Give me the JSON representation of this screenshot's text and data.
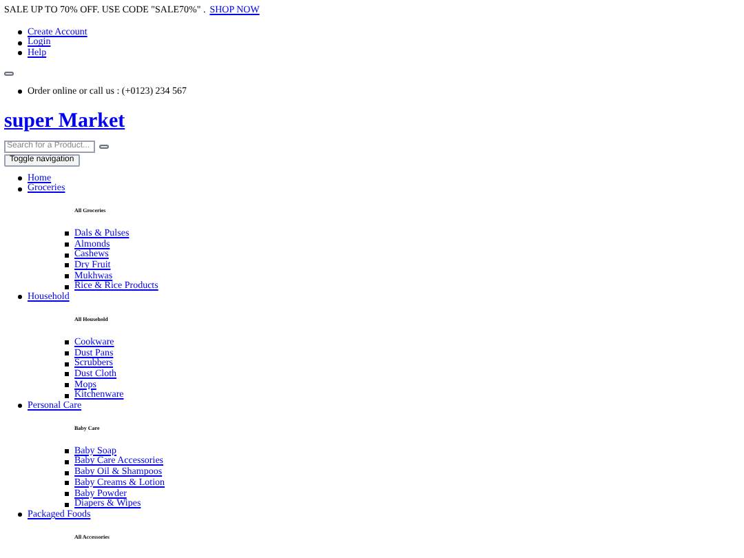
{
  "promo": {
    "text": "SALE UP TO 70% OFF. USE CODE \"SALE70%\" .",
    "link": "SHOP NOW"
  },
  "top_links": [
    "Create Account",
    "Login",
    "Help"
  ],
  "contact": "Order online or call us : (+0123) 234 567",
  "logo": "super Market",
  "search": {
    "placeholder": "Search for a Product..."
  },
  "toggle": "Toggle navigation",
  "nav": [
    {
      "label": "Home"
    },
    {
      "label": "Groceries",
      "heading": "All Groceries",
      "children": [
        "Dals & Pulses",
        "Almonds",
        "Cashews",
        "Dry Fruit",
        "Mukhwas",
        "Rice & Rice Products"
      ]
    },
    {
      "label": "Household",
      "heading": "All Household",
      "children": [
        "Cookware",
        "Dust Pans",
        "Scrubbers",
        "Dust Cloth",
        "Mops",
        "Kitchenware"
      ]
    },
    {
      "label": "Personal Care",
      "heading": "Baby Care",
      "children": [
        "Baby Soap",
        "Baby Care Accessories",
        "Baby Oil & Shampoos",
        "Baby Creams & Lotion",
        "Baby Powder",
        "Diapers & Wipes"
      ]
    },
    {
      "label": "Packaged Foods",
      "heading": "All Accessories"
    }
  ]
}
